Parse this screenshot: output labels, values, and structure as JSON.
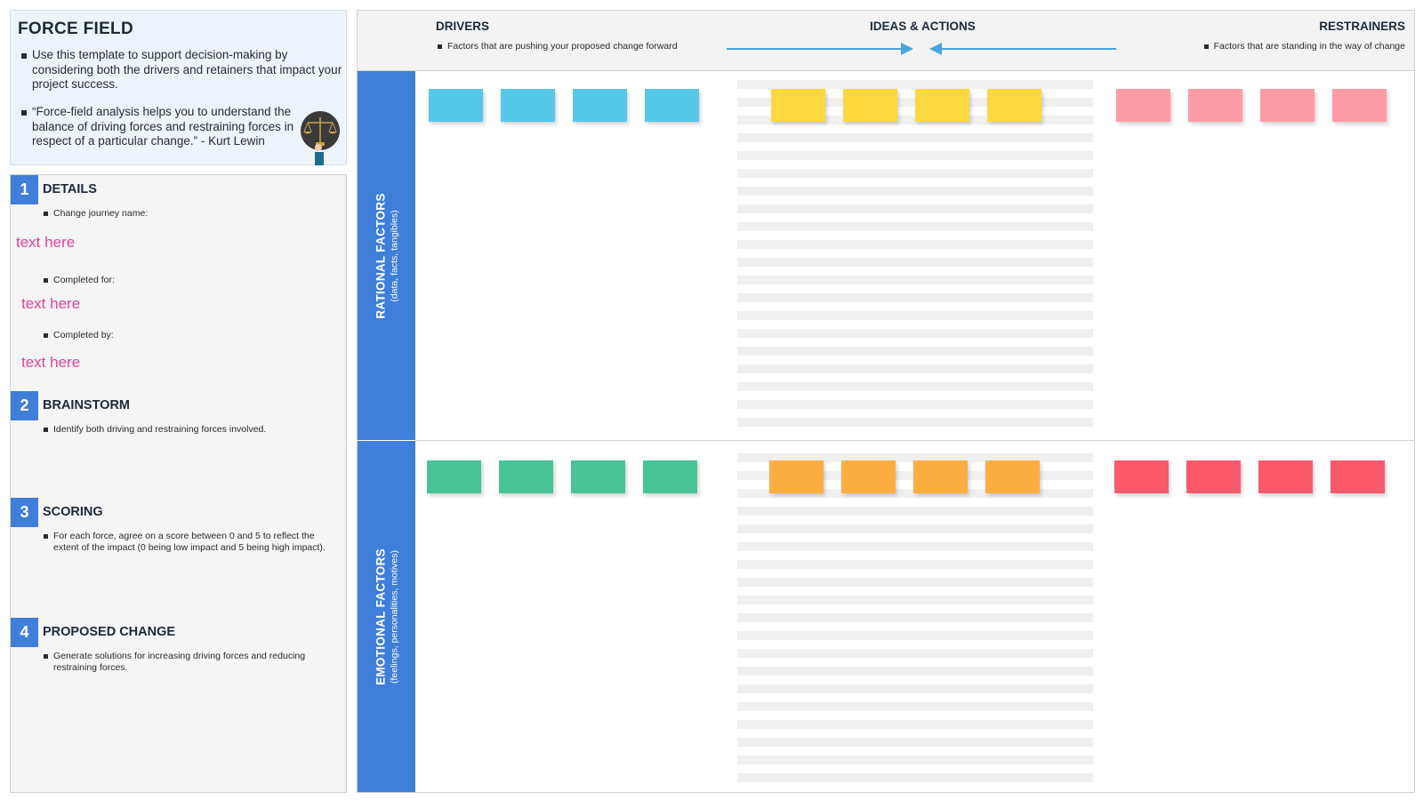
{
  "intro": {
    "title": "FORCE FIELD",
    "bullet1": "Use this template to support decision-making by considering both the drivers and retainers that impact your project success.",
    "bullet2": "“Force-field analysis helps you to understand the balance of driving forces and restraining forces in respect of a particular change.” - Kurt Lewin",
    "icon": "scale-of-justice-icon"
  },
  "steps": [
    {
      "num": "1",
      "title": "DETAILS",
      "fields": [
        {
          "label": "Change journey name:",
          "value": "text here"
        },
        {
          "label": "Completed for:",
          "value": "text here"
        },
        {
          "label": "Completed by:",
          "value": "text here"
        }
      ]
    },
    {
      "num": "2",
      "title": "BRAINSTORM",
      "text": "Identify both driving and restraining forces involved."
    },
    {
      "num": "3",
      "title": "SCORING",
      "text": "For each force, agree on a score between 0 and 5 to reflect the extent of the impact (0 being low impact and 5 being high impact)."
    },
    {
      "num": "4",
      "title": "PROPOSED CHANGE",
      "text": "Generate solutions for increasing driving forces and reducing restraining forces."
    }
  ],
  "header": {
    "drivers": "DRIVERS",
    "drivers_note": "Factors that are pushing your proposed change forward",
    "ideas": "IDEAS & ACTIONS",
    "restrainers": "RESTRAINERS",
    "restrainers_note": "Factors that are standing in the way of change"
  },
  "rows": [
    {
      "title": "RATIONAL FACTORS",
      "subtitle": "(data, facts, tangibles)"
    },
    {
      "title": "EMOTIONAL FACTORS",
      "subtitle": "(feelings, personalities, motives)"
    }
  ],
  "colors": {
    "accent_blue": "#3f7fd9",
    "arrow_blue": "#4aa3e0",
    "placeholder_pink": "#e83f9a",
    "rational_drivers": "#57c8e8",
    "rational_ideas": "#fdd83f",
    "rational_restrainers": "#fd9ca6",
    "emotional_drivers": "#48c496",
    "emotional_ideas": "#fdae41",
    "emotional_restrainers": "#fb5a6a"
  }
}
